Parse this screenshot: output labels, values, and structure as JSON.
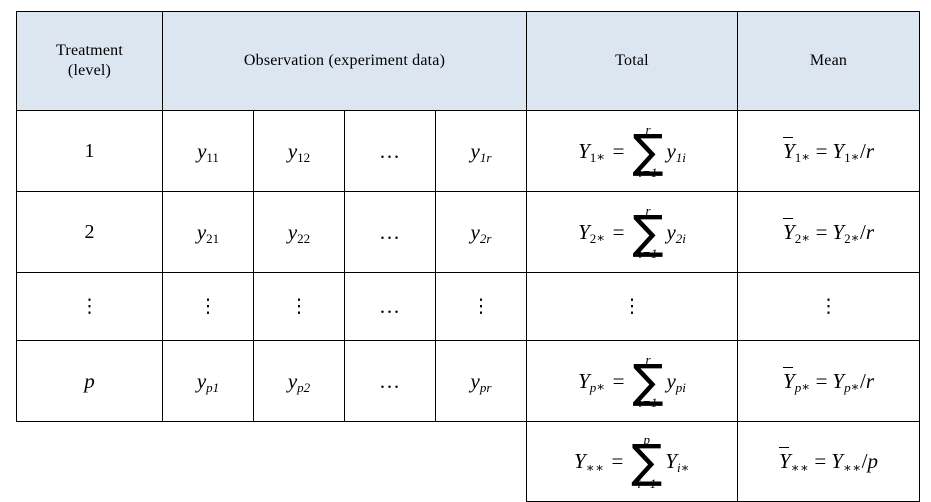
{
  "table": {
    "header": {
      "treatment": "Treatment\n(level)",
      "treatment_line1": "Treatment",
      "treatment_line2": "(level)",
      "observation": "Observation (experiment data)",
      "total": "Total",
      "mean": "Mean"
    },
    "header_bg_color": "#dce6f1",
    "border_color": "#000000",
    "rows": [
      {
        "level": "1",
        "obs": [
          "y11",
          "y12",
          "…",
          "y1r"
        ],
        "total_lhs": "Y1*",
        "total_sum_top": "r",
        "total_sum_bottom": "i=1",
        "total_summand": "y1i",
        "mean": "Ȳ1* = Y1*/r"
      },
      {
        "level": "2",
        "obs": [
          "y21",
          "y22",
          "…",
          "y2r"
        ],
        "total_lhs": "Y2*",
        "total_sum_top": "r",
        "total_sum_bottom": "i=1",
        "total_summand": "y2i",
        "mean": "Ȳ2* = Y2*/r"
      },
      {
        "level": "⋮",
        "obs": [
          "⋮",
          "⋮",
          "…",
          "⋮"
        ],
        "total": "⋮",
        "mean": "⋮"
      },
      {
        "level": "p",
        "obs": [
          "yp1",
          "yp2",
          "…",
          "ypr"
        ],
        "total_lhs": "Yp*",
        "total_sum_top": "r",
        "total_sum_bottom": "i=1",
        "total_summand": "ypi",
        "mean": "Ȳp* = Yp*/r"
      }
    ],
    "grand": {
      "total_lhs": "Y**",
      "total_sum_top": "p",
      "total_sum_bottom": "i=1",
      "total_summand": "Yi*",
      "mean": "Ȳ** = Y**/p"
    },
    "symbols": {
      "sum": "∑",
      "equals": "=",
      "vdots": "⋮",
      "hdots": "…",
      "slash": "/"
    },
    "labels": {
      "y": "y",
      "Y": "Y",
      "r": "r",
      "p": "p",
      "i": "i",
      "star": "∗",
      "doublestar": "∗∗",
      "i_eq_1": "i=1",
      "sub_11": "11",
      "sub_12": "12",
      "sub_1r": "1r",
      "sub_1i": "1i",
      "sub_1": "1",
      "sub_21": "21",
      "sub_22": "22",
      "sub_2r": "2r",
      "sub_2i": "2i",
      "sub_2": "2",
      "sub_p1": "p1",
      "sub_p2": "p2",
      "sub_pr": "pr",
      "sub_pi": "pi",
      "sub_p": "p",
      "sub_i": "i"
    }
  }
}
